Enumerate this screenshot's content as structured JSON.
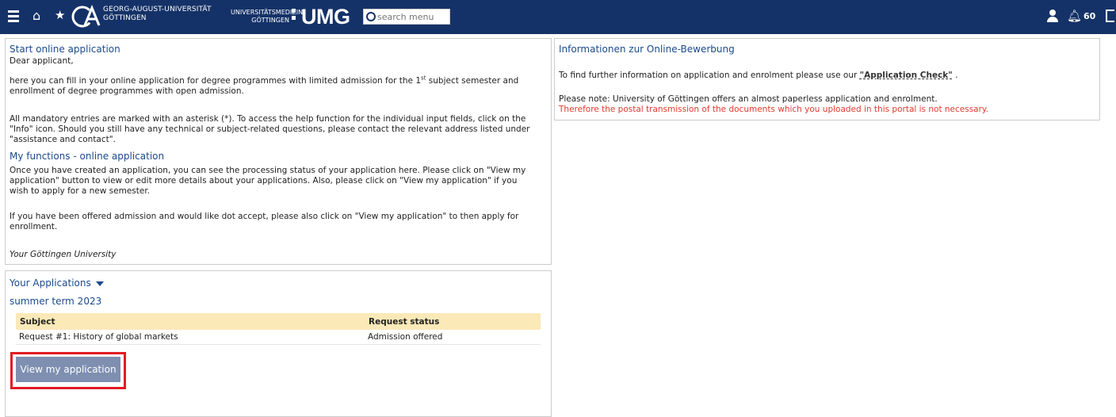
{
  "header": {
    "university_line1": "GEORG-AUGUST-UNIVERSITÄT",
    "university_line2": "GÖTTINGEN",
    "umg_line1": "UNIVERSITÄTSMEDIZIN",
    "umg_line2": "GÖTTINGEN",
    "umg_logo": "UMG",
    "search_placeholder": "search menu",
    "notification_count": "60",
    "icons": [
      "menu-icon",
      "home-icon",
      "star-icon",
      "search-icon",
      "user-icon",
      "bell-icon",
      "logout-icon"
    ],
    "bar_color": "#153268"
  },
  "start": {
    "title": "Start online application",
    "greeting": "Dear applicant,",
    "p1_before": "here you can fill in your online application for degree programmes with limited admission  for the 1",
    "p1_sup": "st",
    "p1_after": " subject semester and enrollment of degree programmes with open admission.",
    "p2": " All mandatory entries are marked with an asterisk (*). To access the help function for the individual input fields, click on the \"Info\" icon. Should you still have any technical or subject-related questions, please contact the relevant address listed under \"assistance and contact\".",
    "functions_title": "My functions - online application",
    "p3": "Once you have created an application, you can see the processing status of your application here. Please click on \"View my application\" button to view or edit more details about your applications. Also, please click on \"View my application\" if you wish to apply for a new semester.",
    "p4": "If you have been offered admission and would like dot accept, please also click on \"View my application\" to then apply for enrollment.",
    "signature": "Your Göttingen University"
  },
  "info": {
    "title": "Informationen zur Online-Bewerbung",
    "line1_before": "To find further information on application and enrolment please use our ",
    "link": "\"Application Check\"",
    "line1_after": " .",
    "note": "Please note: University of Göttingen offers an almost paperless application and enrolment.",
    "note_red": "Therefore the postal transmission of the documents which you uploaded in this portal is not necessary.",
    "red_color": "#e03a2e"
  },
  "applications": {
    "title": "Your Applications",
    "term": "summer term 2023",
    "columns": [
      "Subject",
      "Request status"
    ],
    "rows": [
      [
        "Request #1: History of global markets",
        "Admission offered"
      ]
    ],
    "button": "View my application",
    "header_color": "#fbe9b8",
    "button_color": "#7e8fb0",
    "highlight_color": "#e11c24"
  }
}
